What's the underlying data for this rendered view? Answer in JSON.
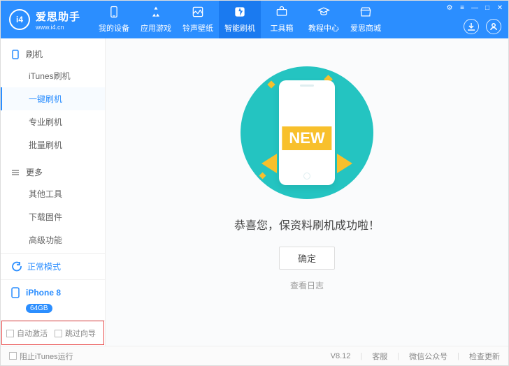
{
  "header": {
    "logo_letters": "i4",
    "brand": "爱思助手",
    "subbrand": "www.i4.cn",
    "tabs": [
      {
        "label": "我的设备"
      },
      {
        "label": "应用游戏"
      },
      {
        "label": "铃声壁纸"
      },
      {
        "label": "智能刷机",
        "active": true
      },
      {
        "label": "工具箱"
      },
      {
        "label": "教程中心"
      },
      {
        "label": "爱思商城"
      }
    ]
  },
  "sidebar": {
    "sections": [
      {
        "title": "刷机",
        "items": [
          {
            "label": "iTunes刷机"
          },
          {
            "label": "一键刷机",
            "active": true
          },
          {
            "label": "专业刷机"
          },
          {
            "label": "批量刷机"
          }
        ]
      },
      {
        "title": "更多",
        "items": [
          {
            "label": "其他工具"
          },
          {
            "label": "下载固件"
          },
          {
            "label": "高级功能"
          }
        ]
      }
    ],
    "status": {
      "label": "正常模式"
    },
    "device": {
      "name": "iPhone 8",
      "storage": "64GB"
    },
    "checks": [
      {
        "label": "自动激活"
      },
      {
        "label": "跳过向导"
      }
    ]
  },
  "main": {
    "ribbon_text": "NEW",
    "message": "恭喜您，保资料刷机成功啦！",
    "confirm_label": "确定",
    "log_label": "查看日志"
  },
  "footer": {
    "block_itunes": "阻止iTunes运行",
    "version": "V8.12",
    "links": [
      "客服",
      "微信公众号",
      "检查更新"
    ]
  }
}
